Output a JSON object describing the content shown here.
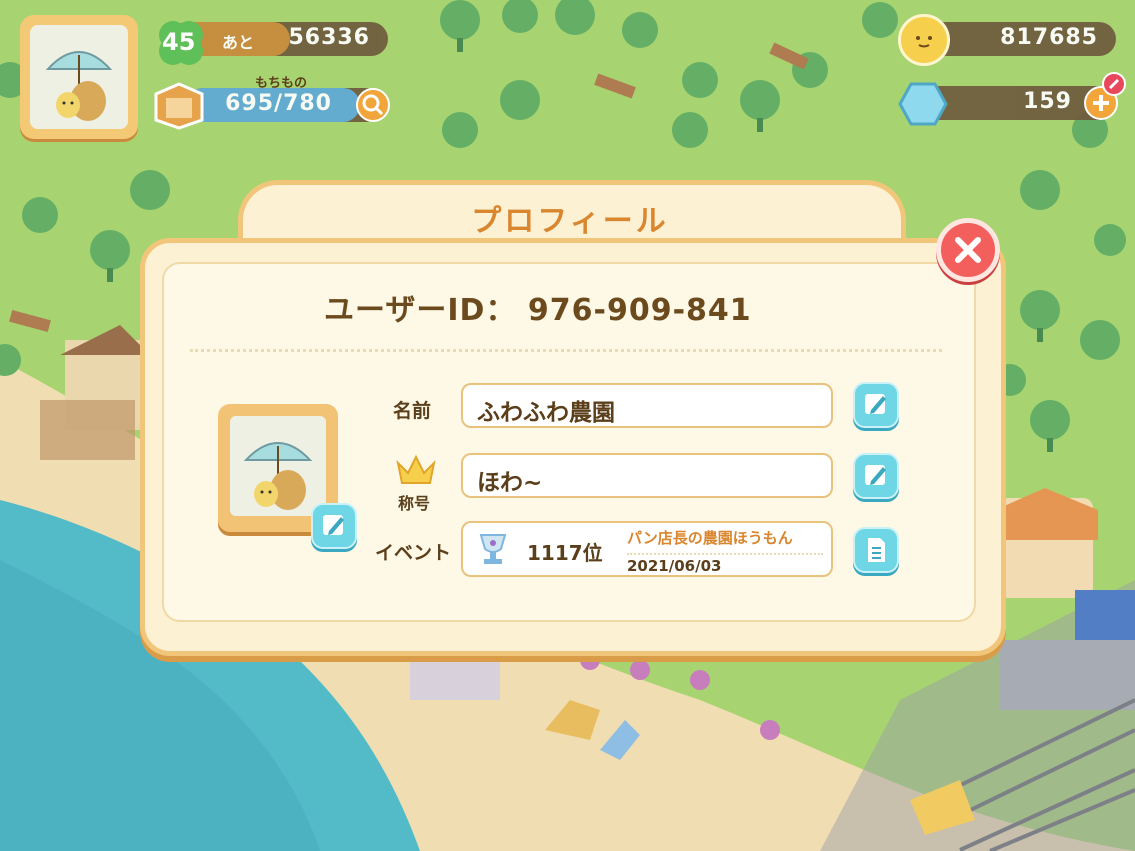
{
  "hud": {
    "level": "45",
    "remaining_label": "あと",
    "remaining_exp": "56336",
    "exp_progress": 0.55,
    "inventory_label": "もちもの",
    "inventory_count": "695/780",
    "inventory_progress": 0.89,
    "coins": "817685",
    "gems": "159"
  },
  "profile": {
    "title": "プロフィール",
    "user_id_text": "ユーザーID：  976-909-841",
    "name_label": "名前",
    "name_value": "ふわふわ農園",
    "title_label": "称号",
    "title_value": "ほわ~",
    "event_label": "イベント",
    "event_rank": "1117位",
    "event_name": "パン店長の農園ほうもん",
    "event_date": "2021/06/03"
  },
  "icons": {
    "close": "close-icon",
    "edit": "pencil-edit-icon",
    "document": "document-icon",
    "crown": "crown-icon",
    "trophy": "trophy-icon",
    "clover": "clover-icon",
    "box": "box-icon",
    "search": "magnifier-icon",
    "coin": "coin-icon",
    "gem": "gem-icon",
    "plus": "plus-icon"
  },
  "colors": {
    "accent_orange": "#d9862f",
    "panel": "#fcf1d2",
    "edit_button": "#6fd6e6",
    "close_red": "#f25f5c"
  }
}
